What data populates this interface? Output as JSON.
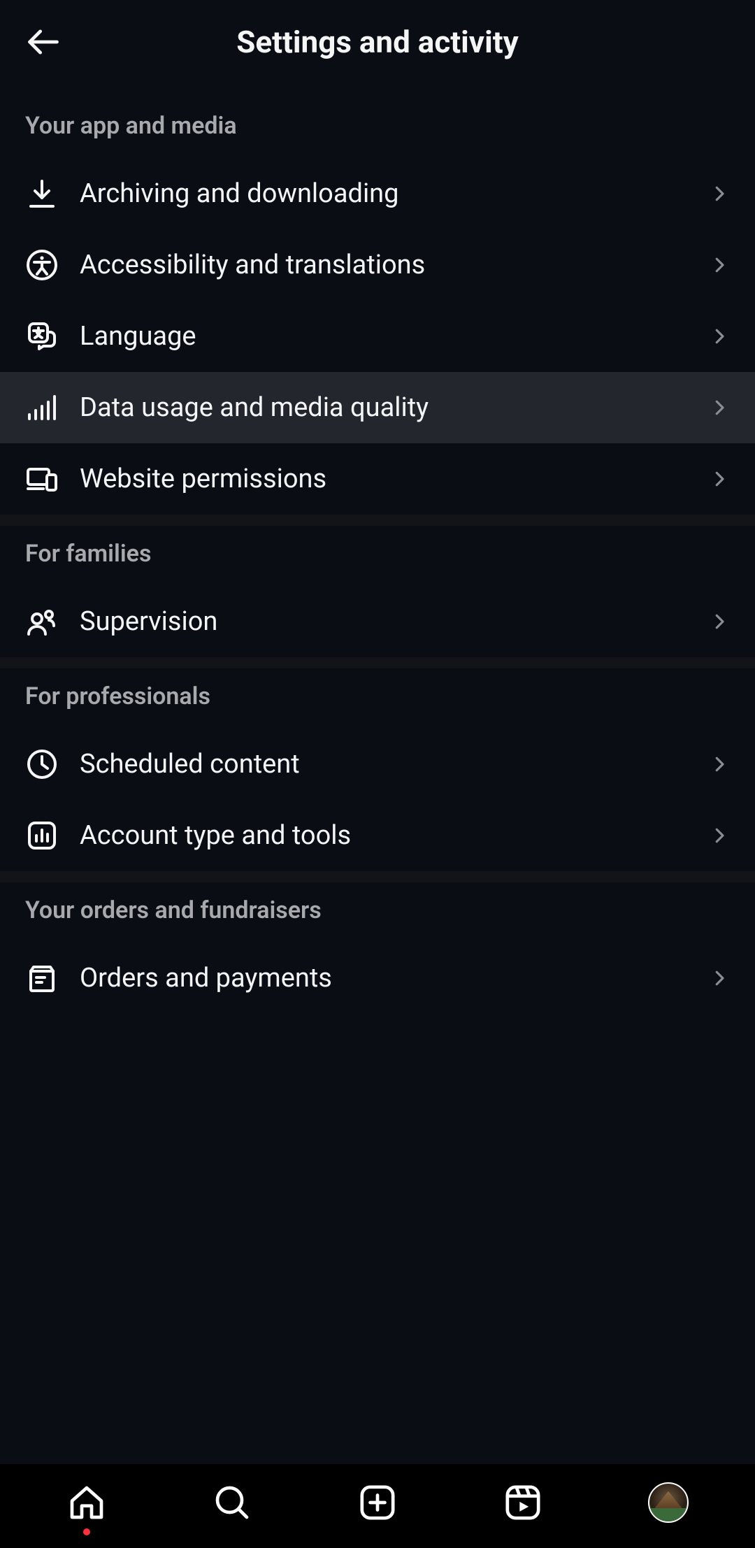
{
  "header": {
    "title": "Settings and activity"
  },
  "sections": [
    {
      "header": "Your app and media",
      "items": [
        {
          "label": "Archiving and downloading",
          "icon": "download",
          "highlight": false
        },
        {
          "label": "Accessibility and translations",
          "icon": "accessibility",
          "highlight": false
        },
        {
          "label": "Language",
          "icon": "language",
          "highlight": false
        },
        {
          "label": "Data usage and media quality",
          "icon": "bars",
          "highlight": true
        },
        {
          "label": "Website permissions",
          "icon": "devices",
          "highlight": false
        }
      ]
    },
    {
      "header": "For families",
      "items": [
        {
          "label": "Supervision",
          "icon": "people",
          "highlight": false
        }
      ]
    },
    {
      "header": "For professionals",
      "items": [
        {
          "label": "Scheduled content",
          "icon": "clock",
          "highlight": false
        },
        {
          "label": "Account type and tools",
          "icon": "insights",
          "highlight": false
        }
      ]
    },
    {
      "header": "Your orders and fundraisers",
      "items": [
        {
          "label": "Orders and payments",
          "icon": "orders",
          "highlight": false
        }
      ]
    }
  ],
  "nav": {
    "home_has_dot": true
  }
}
